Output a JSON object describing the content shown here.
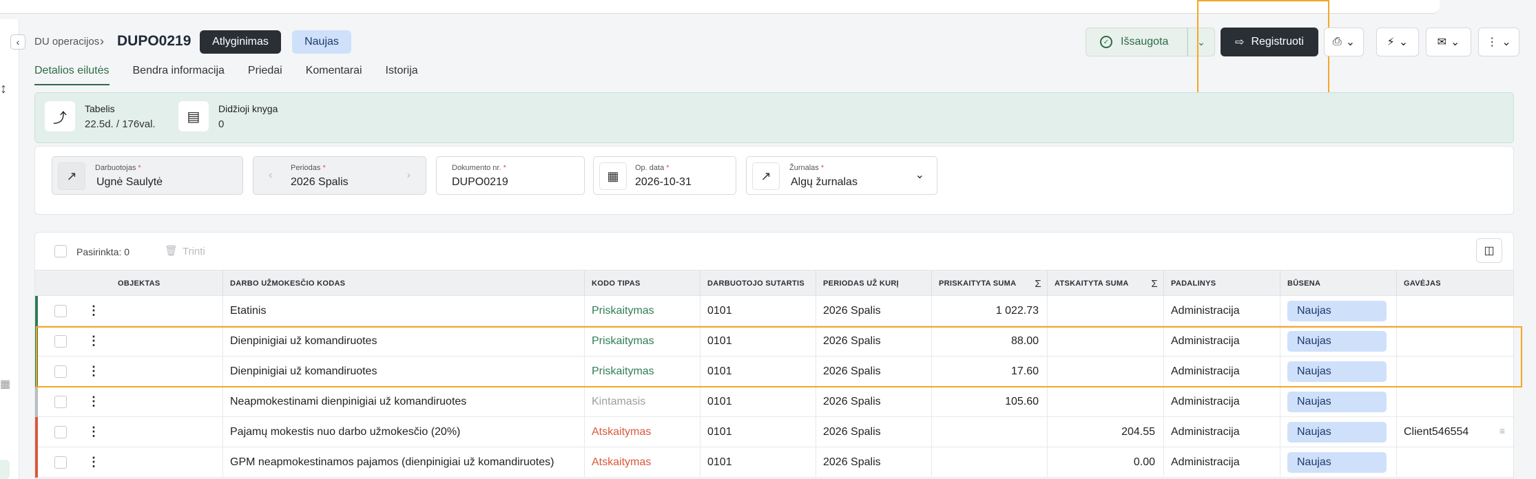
{
  "breadcrumb": {
    "parent": "DU operacijos",
    "current": "DUPO0219"
  },
  "header": {
    "type_badge": "Atlyginimas",
    "status_badge": "Naujas",
    "saved_label": "Išsaugota",
    "register_label": "Registruoti"
  },
  "tabs": [
    "Detalios eilutės",
    "Bendra informacija",
    "Priedai",
    "Komentarai",
    "Istorija"
  ],
  "active_tab": "Detalios eilutės",
  "summary": {
    "timesheet": {
      "label": "Tabelis",
      "value": "22.5d. / 176val."
    },
    "ledger": {
      "label": "Didžioji knyga",
      "value": "0"
    }
  },
  "fields": {
    "employee": {
      "label": "Darbuotojas",
      "value": "Ugnė Saulytė"
    },
    "period": {
      "label": "Periodas",
      "value": "2026 Spalis"
    },
    "doc_no": {
      "label": "Dokumento nr.",
      "value": "DUPO0219"
    },
    "op_date": {
      "label": "Op. data",
      "value": "2026-10-31"
    },
    "journal": {
      "label": "Žurnalas",
      "value": "Algų žurnalas"
    },
    "required_mark": "*"
  },
  "table": {
    "selected_label": "Pasirinkta: 0",
    "delete_label": "Trinti",
    "columns": [
      "OBJEKTAS",
      "DARBO UŽMOKESČIO KODAS",
      "KODO TIPAS",
      "DARBUOTOJO SUTARTIS",
      "PERIODAS UŽ KURĮ",
      "PRISKAITYTA SUMA",
      "ATSKAITYTA SUMA",
      "PADALINYS",
      "BŪSENA",
      "GAVĖJAS"
    ],
    "sum_symbol": "Σ",
    "rows": [
      {
        "code": "Etatinis",
        "type": "Priskaitymas",
        "contract": "0101",
        "period": "2026 Spalis",
        "accrued": "1 022.73",
        "deducted": "",
        "unit": "Administracija",
        "status": "Naujas",
        "recipient": ""
      },
      {
        "code": "Dienpinigiai už komandiruotes",
        "type": "Priskaitymas",
        "contract": "0101",
        "period": "2026 Spalis",
        "accrued": "88.00",
        "deducted": "",
        "unit": "Administracija",
        "status": "Naujas",
        "recipient": ""
      },
      {
        "code": "Dienpinigiai už komandiruotes",
        "type": "Priskaitymas",
        "contract": "0101",
        "period": "2026 Spalis",
        "accrued": "17.60",
        "deducted": "",
        "unit": "Administracija",
        "status": "Naujas",
        "recipient": ""
      },
      {
        "code": "Neapmokestinami dienpinigiai už komandiruotes",
        "type": "Kintamasis",
        "contract": "0101",
        "period": "2026 Spalis",
        "accrued": "105.60",
        "deducted": "",
        "unit": "Administracija",
        "status": "Naujas",
        "recipient": ""
      },
      {
        "code": "Pajamų mokestis nuo darbo užmokesčio (20%)",
        "type": "Atskaitymas",
        "contract": "0101",
        "period": "2026 Spalis",
        "accrued": "",
        "deducted": "204.55",
        "unit": "Administracija",
        "status": "Naujas",
        "recipient": "Client546554"
      },
      {
        "code": "GPM neapmokestinamos pajamos (dienpinigiai už komandiruotes)",
        "type": "Atskaitymas",
        "contract": "0101",
        "period": "2026 Spalis",
        "accrued": "",
        "deducted": "0.00",
        "unit": "Administracija",
        "status": "Naujas",
        "recipient": ""
      }
    ]
  },
  "colors": {
    "accent_green": "#2f6b48",
    "type_accrual": "#2f7d55",
    "type_variable": "#9a9ea3",
    "type_deduction": "#d9583b",
    "status_blue": "#cfe0fb",
    "highlight_orange": "#f5a623"
  }
}
